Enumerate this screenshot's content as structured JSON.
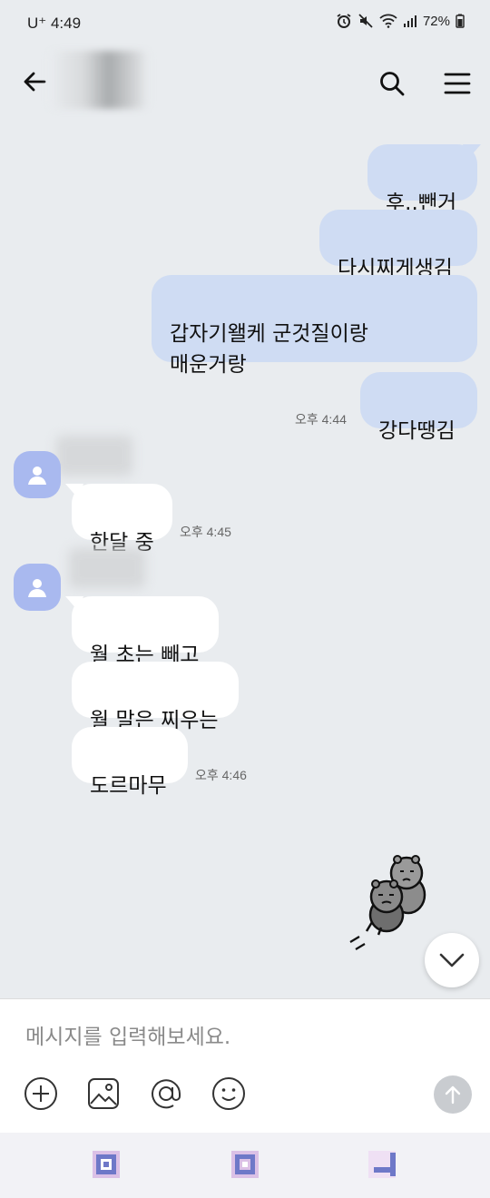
{
  "status_bar": {
    "carrier_time": "U⁺ 4:49",
    "battery": "72%"
  },
  "header": {
    "back_icon": "arrow-left-icon",
    "search_icon": "search-icon",
    "menu_icon": "hamburger-menu-icon"
  },
  "messages": {
    "me": [
      {
        "text": "후..뺀거"
      },
      {
        "text": "다시찌게생김"
      },
      {
        "text": "갑자기왤케 군것질이랑\n매운거랑"
      },
      {
        "text": "강다땡김"
      }
    ],
    "me_time": "오후 4:44",
    "group1": {
      "text": "한달 중",
      "time": "오후 4:45"
    },
    "group2": [
      {
        "text": "월 초는 빼고"
      },
      {
        "text": "월 말은 찌우는"
      },
      {
        "text": "도르마무"
      }
    ],
    "group2_time": "오후 4:46"
  },
  "input": {
    "placeholder": "메시지를 입력해보세요."
  },
  "toolbar": {
    "icons": [
      "plus-icon",
      "image-icon",
      "mention-icon",
      "emoji-icon",
      "send-icon"
    ]
  },
  "colors": {
    "background": "#e9ecef",
    "my_bubble": "#cfdcf3",
    "other_bubble": "#ffffff",
    "avatar": "#a9b9ef"
  }
}
